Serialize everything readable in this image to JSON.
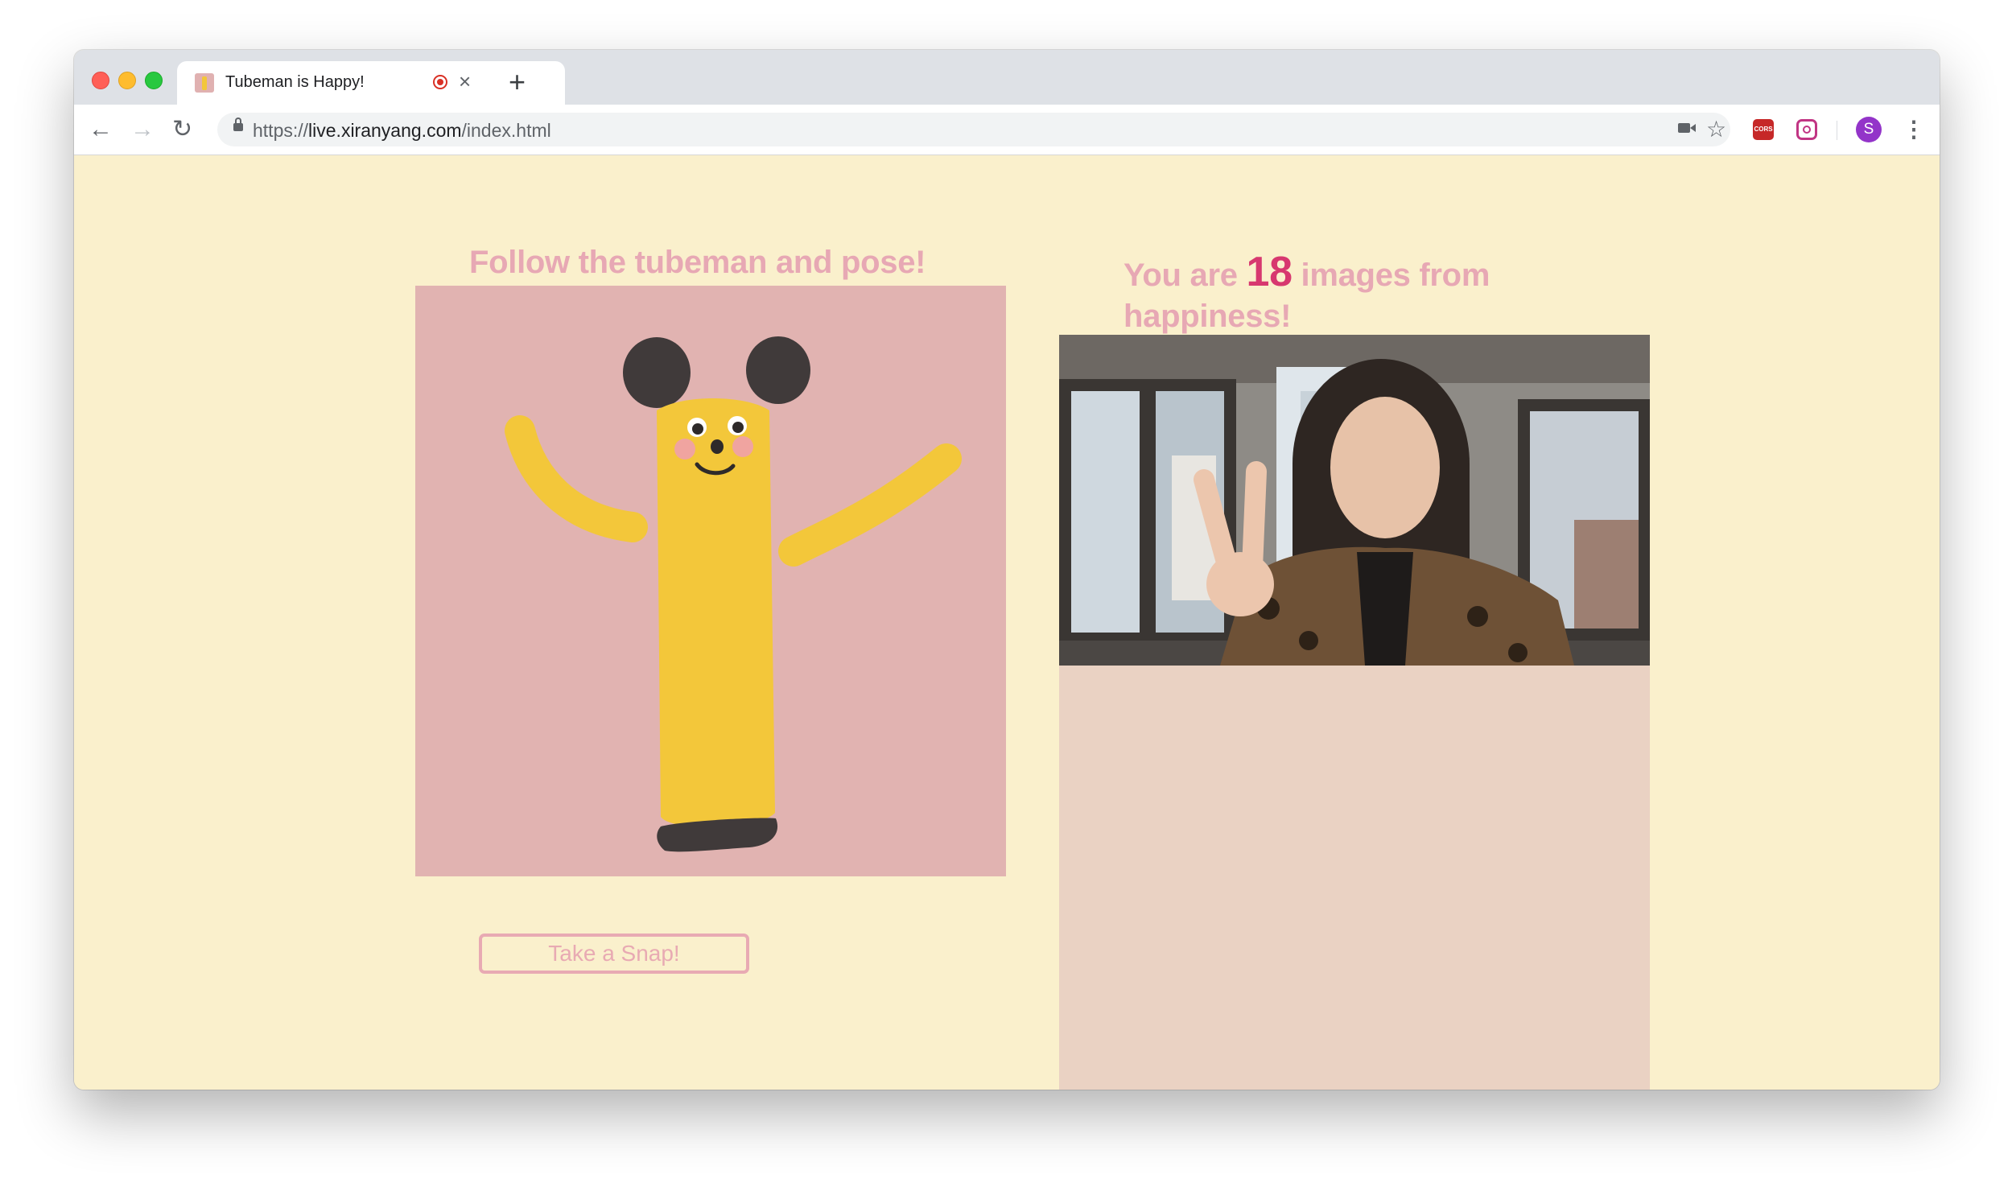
{
  "browser": {
    "tab": {
      "title": "Tubeman is Happy!",
      "close_glyph": "×"
    },
    "new_tab_glyph": "+",
    "nav": {
      "back_glyph": "←",
      "forward_glyph": "→",
      "reload_glyph": "↻"
    },
    "url": {
      "scheme": "https://",
      "host": "live.xiranyang.com",
      "path": "/index.html"
    },
    "star_glyph": "☆",
    "camera_glyph": "■",
    "extensions": [
      "CORS",
      "Instagram"
    ],
    "avatar_letter": "S",
    "menu_glyph": "⋮"
  },
  "page": {
    "left_heading": "Follow the tubeman and pose!",
    "right_heading_prefix": "You are ",
    "image_count": "18",
    "right_heading_suffix": " images from happiness!",
    "snap_button": "Take a Snap!"
  },
  "colors": {
    "page_bg": "#faf0cc",
    "heading": "#e7a8b4",
    "count": "#d7386f",
    "tubeman_panel": "#e1b3b1",
    "gallery_panel": "#ead2c3",
    "tubeman_yellow": "#f3c73a"
  },
  "icons": {
    "tubeman": "tubeman-illustration",
    "webcam": "webcam-feed"
  }
}
